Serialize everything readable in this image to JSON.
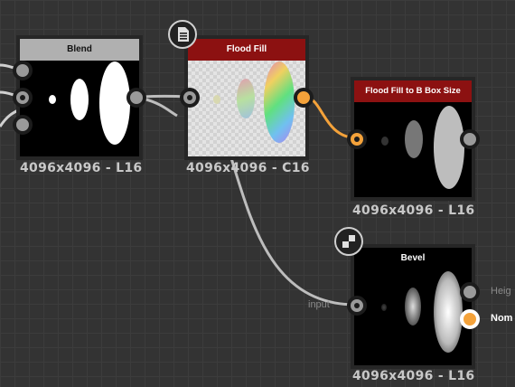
{
  "nodes": {
    "blend": {
      "title": "Blend",
      "resolution": "4096x4096 - L16"
    },
    "flood_fill": {
      "title": "Flood Fill",
      "resolution": "4096x4096 - C16"
    },
    "flood_fill_bbox": {
      "title": "Flood Fill to B Box Size",
      "resolution": "4096x4096 - L16"
    },
    "bevel": {
      "title": "Bevel",
      "resolution": "4096x4096 - L16",
      "input_label": "input",
      "output_height_label": "Heig",
      "output_normal_label": "Nom"
    }
  },
  "icons": {
    "flood_fill_badge": "document-icon",
    "bevel_badge": "checker-icon"
  },
  "colors": {
    "canvas": "#333333",
    "wire_gray": "#bdbdbd",
    "wire_orange": "#f4a23a",
    "header_red": "#8c1111",
    "header_gray": "#b0b0b0"
  }
}
